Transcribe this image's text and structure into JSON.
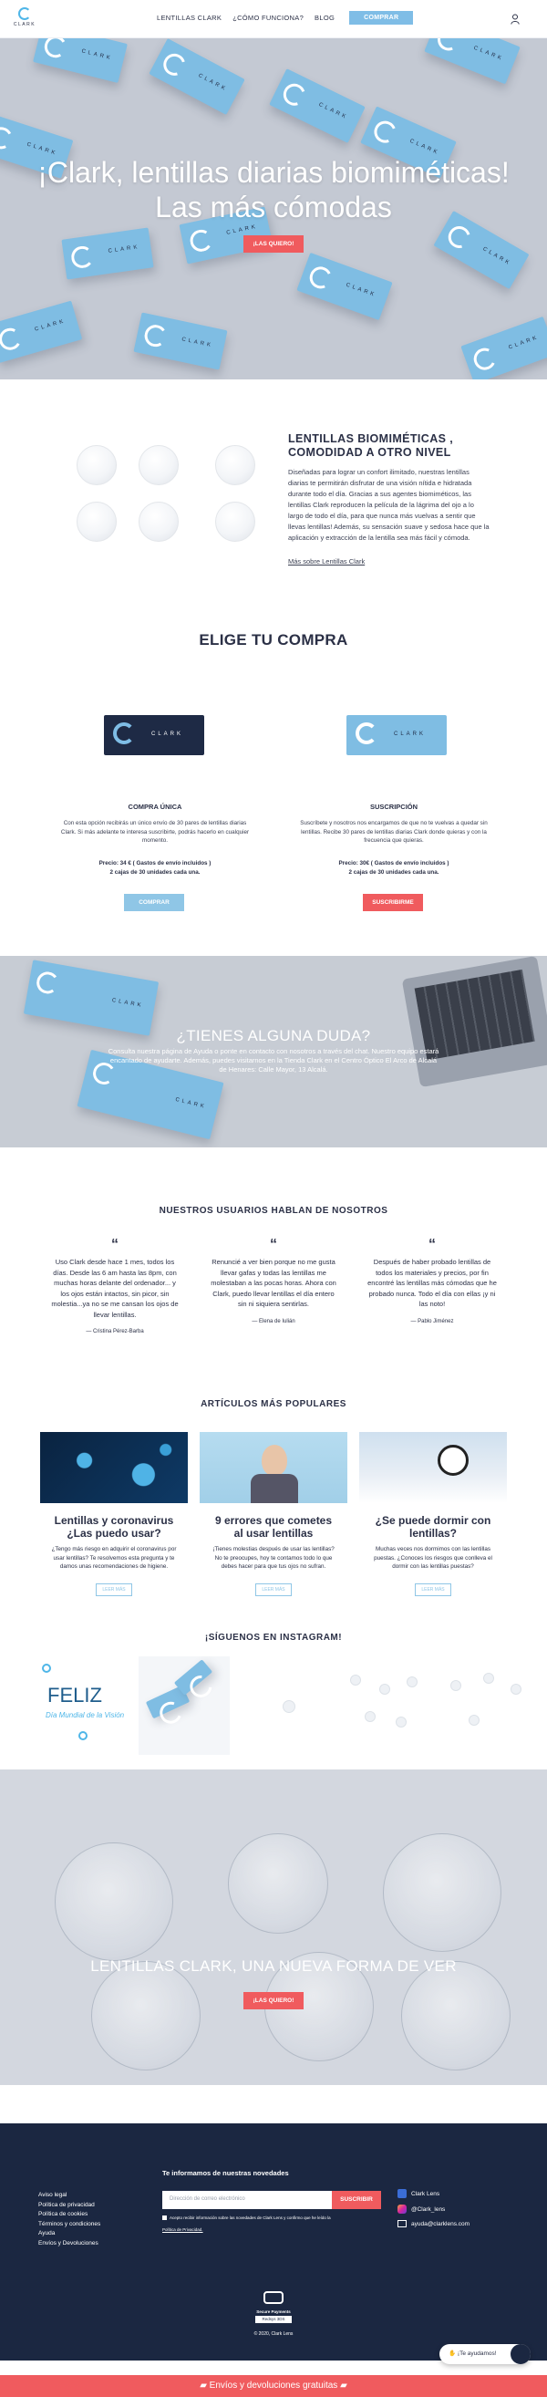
{
  "header": {
    "logo_text": "CLARK",
    "nav": [
      "LENTILLAS CLARK",
      "¿CÓMO FUNCIONA?",
      "BLOG"
    ],
    "cta": "COMPRAR"
  },
  "hero": {
    "title_line1": "¡Clark, lentillas diarias biomiméticas!",
    "title_line2": "Las más cómodas",
    "cta": "¡LAS QUIERO!",
    "box_text": "CLARK"
  },
  "intro": {
    "title_line1": "LENTILLAS BIOMIMÉTICAS ,",
    "title_line2": "COMODIDAD A OTRO NIVEL",
    "lines": [
      "Diseñadas para lograr un confort ilimitado, nuestras lentillas",
      "diarias te permitirán disfrutar de una visión nítida e hidratada",
      "durante todo el día.  Gracias a sus agentes biomiméticos, las",
      "lentillas Clark reproducen la película de la lágrima del ojo a lo",
      "largo de todo el día, para que nunca más vuelvas a sentir que",
      "llevas lentillas! Además, su sensación suave y sedosa hace que la",
      "aplicación y extracción de la lentilla sea más fácil y cómoda."
    ],
    "link": "Más sobre Lentillas Clark"
  },
  "purchase": {
    "title": "ELIGE TU COMPRA",
    "single": {
      "title": "COMPRA ÚNICA",
      "text": [
        "Con esta opción recibirás un único envío de 30 pares de lentillas diarias",
        "Clark. Si más adelante te interesa suscribirte, podrás hacerlo en cualquier",
        "momento."
      ],
      "price": "Precio: 34 € ( Gastos de envío incluidos )",
      "qty": "2 cajas de 30 unidades cada una.",
      "button": "COMPRAR"
    },
    "sub": {
      "title": "SUSCRIPCIÓN",
      "text": [
        "Suscríbete y nosotros nos encargamos de que no te vuelvas a quedar sin",
        "lentillas. Recibe 30 pares de lentillas diarias Clark donde quieras y con la",
        "frecuencia que quieras."
      ],
      "price": "Precio: 30€ ( Gastos de envío incluidos )",
      "qty": "2 cajas de 30 unidades cada una.",
      "button": "SUSCRIBIRME"
    }
  },
  "faq": {
    "title": "¿TIENES ALGUNA DUDA?",
    "lines": [
      "Consulta nuestra página de Ayuda o ponte en contacto con nosotros a través del chat. Nuestro equipo estará",
      "encantado de ayudarte. Además, puedes visitarnos en la Tienda Clark en el Centro Óptico El Arco de Alcalá",
      "de Henares: Calle Mayor, 13 Alcalá."
    ]
  },
  "testimonials": {
    "title": "NUESTROS USUARIOS HABLAN DE NOSOTROS",
    "items": [
      {
        "lines": [
          "Uso Clark desde hace 1 mes, todos los",
          "días. Desde las 6 am hasta las 8pm, con",
          "muchas horas delante del ordenador... y",
          "los ojos están intactos, sin picor, sin",
          "molestia...ya no se me cansan los ojos de",
          "llevar lentillas."
        ],
        "author": "— Cristina Pérez-Barba"
      },
      {
        "lines": [
          "Renuncié a ver bien porque no me gusta",
          "llevar gafas y todas las lentillas me",
          "molestaban a las pocas horas. Ahora con",
          "Clark, puedo llevar lentillas el día entero",
          "sin ni siquiera sentirlas."
        ],
        "author": "— Elena de Iulián"
      },
      {
        "lines": [
          "Después de haber probado lentillas de",
          "todos los materiales y precios, por fin",
          "encontré las lentillas más cómodas que he",
          "probado nunca. Todo el día con ellas ¡y ni",
          "las noto!"
        ],
        "author": "— Pablo Jiménez"
      }
    ]
  },
  "articles": {
    "title": "ARTÍCULOS MÁS POPULARES",
    "items": [
      {
        "title": [
          "Lentillas y coronavirus",
          "¿Las puedo usar?"
        ],
        "text": [
          "¿Tengo más riesgo en adquirir el coronavirus por",
          "usar lentillas? Te resolvemos esta pregunta y te",
          "damos unas recomendaciones de higiene."
        ],
        "button": "LEER MÁS"
      },
      {
        "title": [
          "9 errores que cometes",
          "al usar lentillas"
        ],
        "text": [
          "¡Tienes molestias después de usar las lentillas?",
          "No te preocupes, hoy te contamos todo lo que",
          "debes hacer para que tus ojos no sufran."
        ],
        "button": "LEER MÁS"
      },
      {
        "title": [
          "¿Se puede dormir con",
          "lentillas?"
        ],
        "text": [
          "Muchas veces nos dormimos con las lentillas",
          "puestas. ¿Conoces los riesgos que conlleva el",
          "dormir con las lentillas puestas?"
        ],
        "button": "LEER MÁS"
      }
    ]
  },
  "instagram": {
    "title": "¡SÍGUENOS EN INSTAGRAM!",
    "post1_big": "FELIZ",
    "post1_small": "Día Mundial de la Visión"
  },
  "hero2": {
    "title": "LENTILLAS CLARK, UNA NUEVA FORMA DE VER",
    "cta": "¡LAS QUIERO!"
  },
  "footer": {
    "links": [
      "Aviso legal",
      "Política de privacidad",
      "Política de cookies",
      "Términos y condiciones",
      "Ayuda",
      "Envíos y Devoluciones"
    ],
    "newsletter_title": "Te informamos de nuestras novedades",
    "newsletter_placeholder": "Dirección de correo electrónico",
    "newsletter_button": "SUSCRIBIR",
    "consent": "Acepto recibir información sobre las novedades de Clark Lens y confirmo que he leído la",
    "consent_link": "Política de Privacidad.",
    "social": [
      "Clark Lens",
      "@Clark_lens",
      "ayuda@clarklens.com"
    ],
    "secure_title": "Secure Payments",
    "secure_badge": "Redsys 3DS",
    "copyright": "© 2020, Clark Lens"
  },
  "chat": {
    "label": "¡Te ayudamos!"
  },
  "bottom_bar": {
    "text": "Envíos y devoluciones gratuitas"
  },
  "colors": {
    "accent_blue": "#7fbde6",
    "accent_red": "#f05b5e",
    "navy": "#1b2741"
  }
}
